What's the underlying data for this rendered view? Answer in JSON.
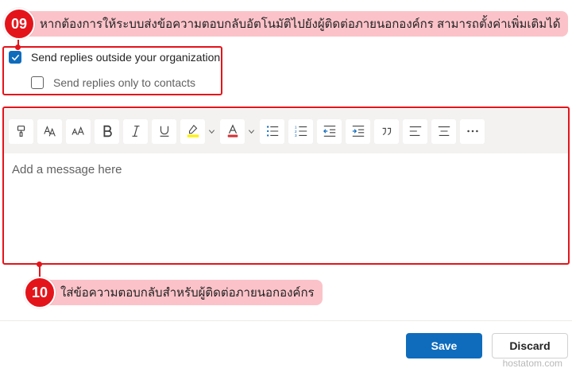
{
  "annotations": {
    "step9": {
      "number": "09",
      "text": "หากต้องการให้ระบบส่งข้อความตอบกลับอัตโนมัติไปยังผู้ติดต่อภายนอกองค์กร สามารถตั้งค่าเพิ่มเติมได้"
    },
    "step10": {
      "number": "10",
      "text": "ใส่ข้อความตอบกลับสำหรับผู้ติดต่อภายนอกองค์กร"
    }
  },
  "options": {
    "outside_org": {
      "label": "Send replies outside your organization",
      "checked": true
    },
    "contacts_only": {
      "label": "Send replies only to contacts",
      "checked": false
    }
  },
  "toolbar": {
    "buttons": [
      "format-painter-icon",
      "font-icon",
      "font-size-icon",
      "bold-icon",
      "italic-icon",
      "underline-icon",
      "highlight-icon",
      "font-color-icon",
      "bullets-icon",
      "numbering-icon",
      "decrease-indent-icon",
      "increase-indent-icon",
      "quote-icon",
      "align-left-icon",
      "align-center-icon",
      "more-options-icon"
    ]
  },
  "editor": {
    "placeholder": "Add a message here"
  },
  "actions": {
    "save_label": "Save",
    "discard_label": "Discard"
  },
  "watermark": "hostatom.com",
  "colors": {
    "accent": "#0f6cbd",
    "callout_red": "#e4141b",
    "callout_bubble": "#fbc3c9",
    "highlight_yellow": "#fff100",
    "font_red": "#d13438"
  }
}
